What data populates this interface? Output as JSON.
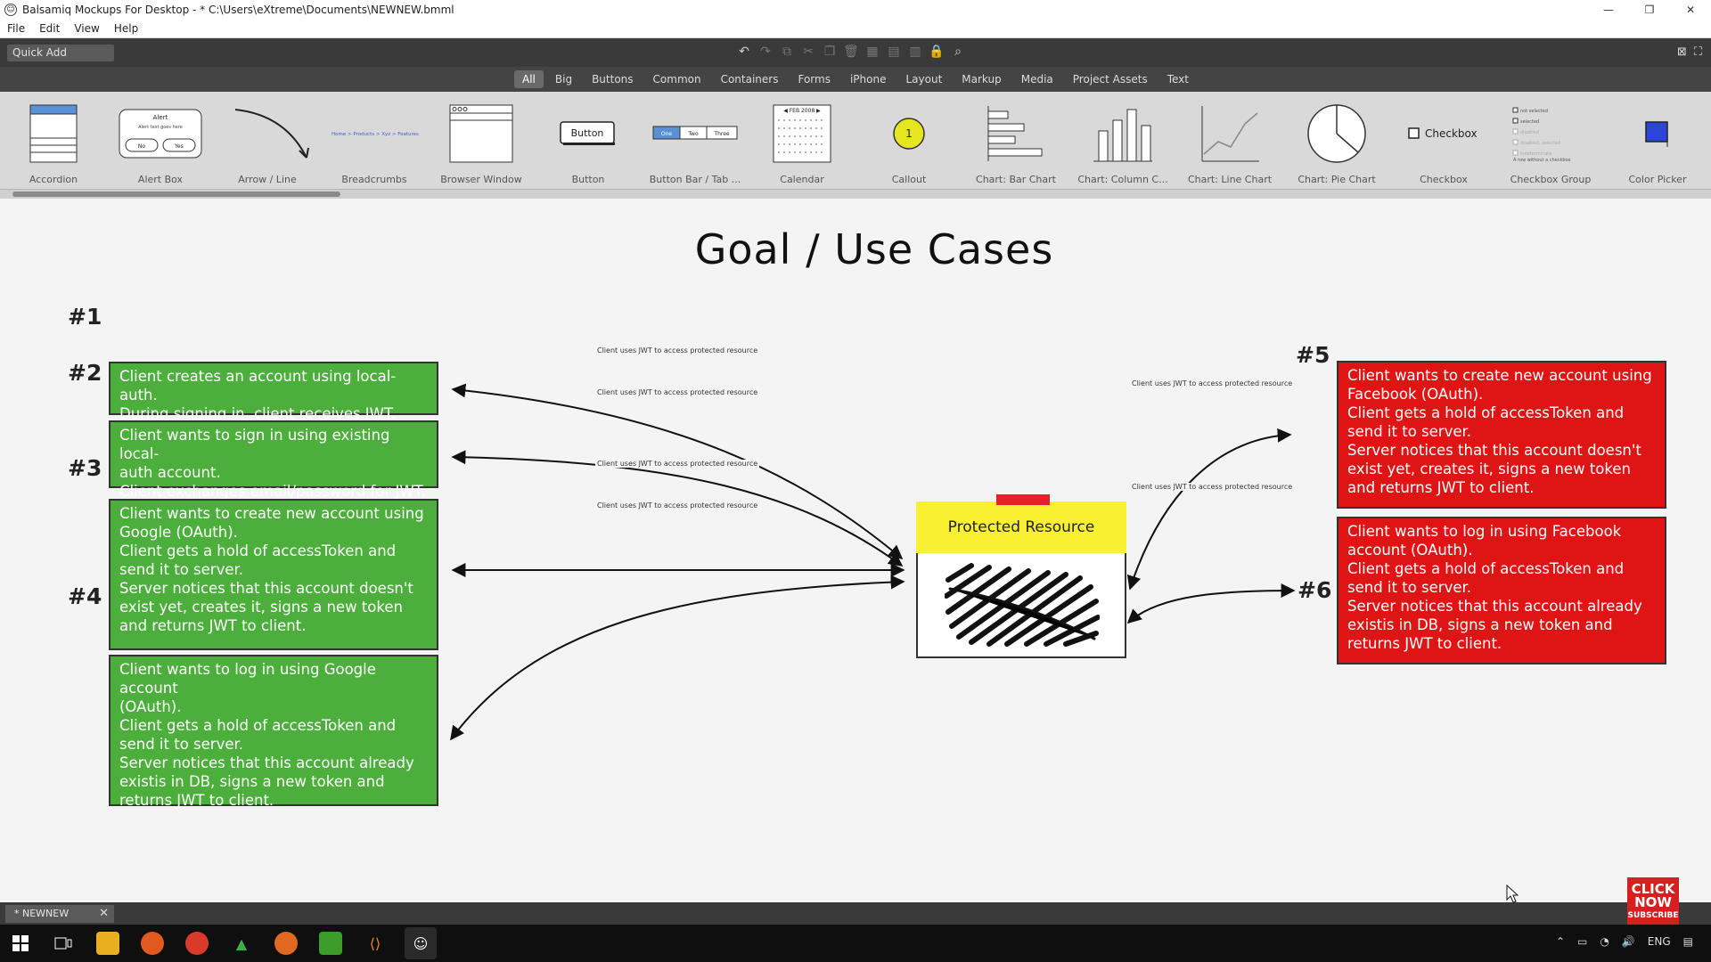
{
  "window": {
    "title": "Balsamiq Mockups For Desktop - * C:\\Users\\eXtreme\\Documents\\NEWNEW.bmml",
    "minimize": "—",
    "maximize": "❐",
    "close": "✕"
  },
  "menu": [
    "File",
    "Edit",
    "View",
    "Help"
  ],
  "quick_add": "Quick Add",
  "library_tabs": [
    "All",
    "Big",
    "Buttons",
    "Common",
    "Containers",
    "Forms",
    "iPhone",
    "Layout",
    "Markup",
    "Media",
    "Project Assets",
    "Text"
  ],
  "active_tab": "All",
  "library_items": [
    "Accordion",
    "Alert Box",
    "Arrow / Line",
    "Breadcrumbs",
    "Browser Window",
    "Button",
    "Button Bar / Tab ...",
    "Calendar",
    "Callout",
    "Chart: Bar Chart",
    "Chart: Column C...",
    "Chart: Line Chart",
    "Chart: Pie Chart",
    "Checkbox",
    "Checkbox Group",
    "Color Picker"
  ],
  "library_thumbs": {
    "alert_title": "Alert",
    "alert_text": "Alert text goes here",
    "alert_btn1": "No",
    "alert_btn2": "Yes",
    "breadcrumbs": "Home > Products > Xyz > Features",
    "button": "Button",
    "bar_one": "One",
    "bar_two": "Two",
    "bar_three": "Three",
    "calendar_header": "◀ FEB 2008 ▶",
    "callout": "1",
    "checkbox": "Checkbox",
    "cbgroup_1": "not selected",
    "cbgroup_2": "selected",
    "cbgroup_3": "disabled",
    "cbgroup_4": "disabled, selected",
    "cbgroup_5": "indeterminate",
    "cbgroup_6": "A row without a checkbox"
  },
  "canvas": {
    "title": "Goal / Use Cases",
    "cases": [
      {
        "num": "#1",
        "lines": [
          "Client creates an account using local-auth.",
          "During signing in, client receives JWT."
        ]
      },
      {
        "num": "#2",
        "lines": [
          "Client wants to sign in using existing local-",
          "auth account.",
          "Client exchanges email/password for JWT."
        ]
      },
      {
        "num": "#3",
        "lines": [
          "Client wants to create new account using",
          "Google (OAuth).",
          "Client gets a hold of accessToken and",
          "send it to server.",
          "Server notices that this account doesn't",
          "exist yet, creates it, signs a new token",
          "and returns JWT to client."
        ]
      },
      {
        "num": "#4",
        "lines": [
          "Client wants to log in using Google account",
          "(OAuth).",
          "Client gets a hold of accessToken and",
          "send it to server.",
          "Server notices that this account already",
          "existis in DB, signs a new token and",
          "returns JWT to client."
        ]
      },
      {
        "num": "#5",
        "lines": [
          "Client wants to create new account using",
          "Facebook (OAuth).",
          "Client gets a hold of accessToken and",
          "send it to server.",
          "Server notices that this account doesn't",
          "exist yet, creates it, signs a new token",
          "and returns JWT to client."
        ]
      },
      {
        "num": "#6",
        "lines": [
          "Client wants to log in using Facebook",
          "account (OAuth).",
          "Client gets a hold of accessToken and",
          "send it to server.",
          "Server notices that this account already",
          "existis in DB, signs a new token and",
          "returns JWT to client."
        ]
      }
    ],
    "arrow_label": "Client uses JWT to access protected resource",
    "protected_title": "Protected Resource"
  },
  "doc_tab": "* NEWNEW",
  "subscribe": {
    "line1": "CLICK",
    "line2": "NOW",
    "line3": "SUBSCRIBE"
  },
  "tray": {
    "lang": "ENG"
  },
  "colors": {
    "green": "#4caf3c",
    "red": "#df1414",
    "yellow": "#f8f030"
  }
}
